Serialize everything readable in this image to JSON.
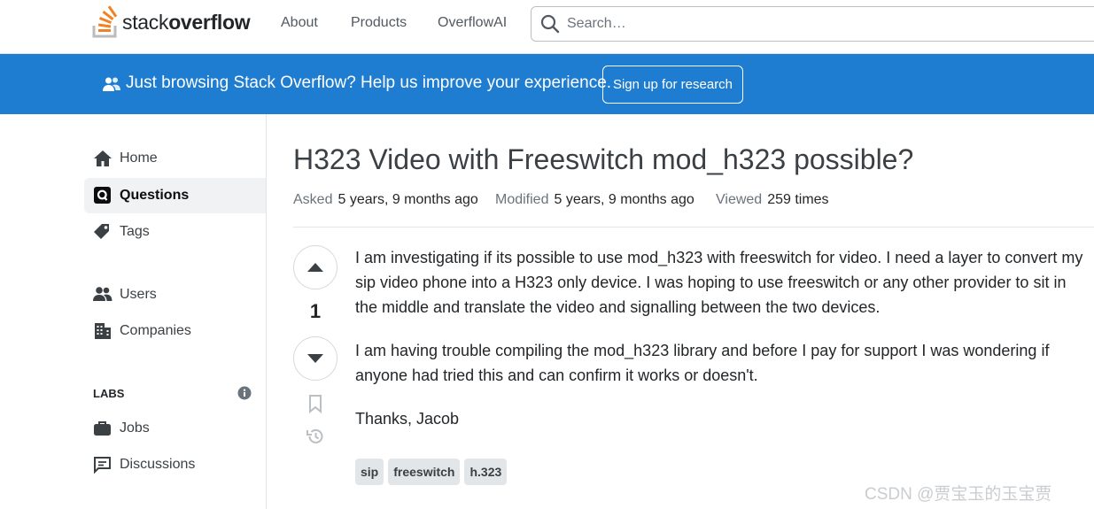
{
  "header": {
    "logo_text_light": "stack",
    "logo_text_bold": "overflow",
    "nav": [
      "About",
      "Products",
      "OverflowAI"
    ],
    "search_placeholder": "Search…"
  },
  "banner": {
    "text": "Just browsing Stack Overflow? Help us improve your experience.",
    "button_label": "Sign up for research"
  },
  "sidebar": {
    "items": [
      {
        "label": "Home",
        "icon": "home-icon"
      },
      {
        "label": "Questions",
        "icon": "questions-icon",
        "active": true
      },
      {
        "label": "Tags",
        "icon": "tag-icon"
      },
      {
        "label": "Users",
        "icon": "users-icon"
      },
      {
        "label": "Companies",
        "icon": "companies-icon"
      }
    ],
    "labs_label": "LABS",
    "labs_items": [
      {
        "label": "Jobs",
        "icon": "briefcase-icon"
      },
      {
        "label": "Discussions",
        "icon": "discussions-icon"
      }
    ]
  },
  "question": {
    "title": "H323 Video with Freeswitch mod_h323 possible?",
    "asked_label": "Asked",
    "asked_value": "5 years, 9 months ago",
    "modified_label": "Modified",
    "modified_value": "5 years, 9 months ago",
    "viewed_label": "Viewed",
    "viewed_value": "259 times",
    "vote_count": "1",
    "paragraphs": [
      "I am investigating if its possible to use mod_h323 with freeswitch for video. I need a layer to convert my sip video phone into a H323 only device. I was hoping to use freeswitch or any other provider to sit in the middle and translate the video and signalling between the two devices.",
      "I am having trouble compiling the mod_h323 library and before I pay for support I was wondering if anyone had tried this and can confirm it works or doesn't.",
      "Thanks, Jacob"
    ],
    "tags": [
      "sip",
      "freeswitch",
      "h.323"
    ]
  },
  "watermark": "CSDN @贾宝玉的玉宝贾",
  "colors": {
    "banner_bg": "#1f7dd1",
    "logo_orange": "#f48024",
    "logo_gray": "#bcbbbb"
  }
}
